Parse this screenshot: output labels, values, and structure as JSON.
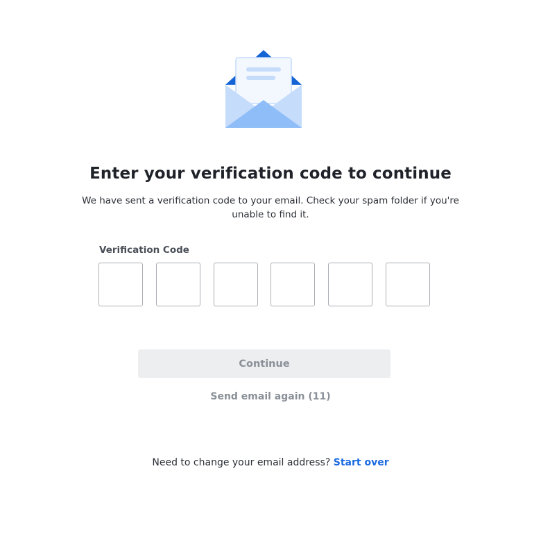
{
  "header": {
    "illustration_icon": "open-envelope-icon",
    "title": "Enter your verification code to continue",
    "subtitle": "We have sent a verification code to your email. Check your spam folder if you're unable to find it."
  },
  "form": {
    "code_label": "Verification Code",
    "code_digits": [
      "",
      "",
      "",
      "",
      "",
      ""
    ],
    "continue_label": "Continue",
    "resend_label": "Send email again (11)"
  },
  "footer": {
    "prompt": "Need to change your email address?",
    "link_label": "Start over"
  },
  "colors": {
    "accent": "#1a6be0",
    "envelope_light": "#c5dcfb",
    "envelope_mid": "#8fbdf7",
    "envelope_dark": "#1464d6",
    "disabled_button_bg": "#eceef0",
    "disabled_text": "#8a9097"
  }
}
